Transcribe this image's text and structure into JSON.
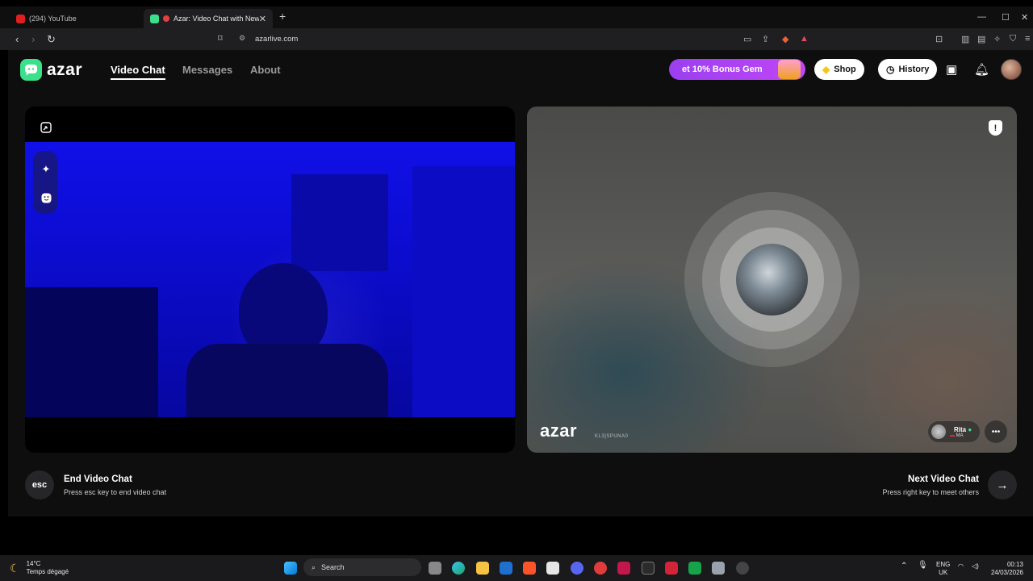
{
  "browser": {
    "tabs": [
      {
        "title": "(294) YouTube",
        "active": false
      },
      {
        "title": "Azar: Video Chat with New Pe",
        "active": true
      }
    ],
    "url": "azarlive.com"
  },
  "header": {
    "brand": "azar",
    "nav": [
      {
        "label": "Video Chat",
        "active": true
      },
      {
        "label": "Messages",
        "active": false
      },
      {
        "label": "About",
        "active": false
      }
    ],
    "promo_label": "et 10% Bonus Gem",
    "shop_label": "Shop",
    "history_label": "History"
  },
  "remote": {
    "watermark": "azar",
    "session_id": "KL3]SPUNA0",
    "user_name": "Rita",
    "user_country": "MA"
  },
  "actions": {
    "end_key": "esc",
    "end_title": "End Video Chat",
    "end_hint": "Press esc key to end video chat",
    "next_title": "Next Video Chat",
    "next_hint": "Press right key to meet others"
  },
  "taskbar": {
    "temperature": "14°C",
    "weather": "Temps dégagé",
    "search_label": "Search",
    "lang_top": "ENG",
    "lang_bottom": "UK",
    "time": "00:13",
    "date": "24/03/2026"
  },
  "colors": {
    "brand_green": "#3ce08a",
    "promo_purple": "#b044f3",
    "camera_blue": "#1010e8"
  }
}
